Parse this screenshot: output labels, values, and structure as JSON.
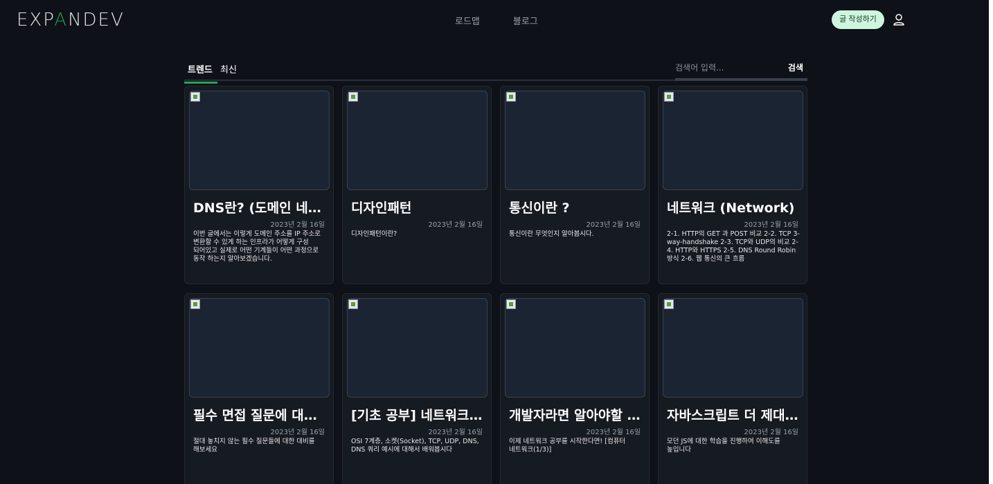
{
  "header": {
    "logo_prefix": "EXP",
    "logo_accent": "A",
    "logo_suffix": "NDEV",
    "nav": [
      {
        "label": "로드맵"
      },
      {
        "label": "블로그"
      }
    ],
    "write_button": "글 작성하기",
    "user_icon": "user-icon"
  },
  "tabs": [
    {
      "label": "트렌드",
      "active": true
    },
    {
      "label": "최신",
      "active": false
    }
  ],
  "search": {
    "placeholder": "검색어 입력...",
    "value": "",
    "button": "검색"
  },
  "colors": {
    "background": "#0e1117",
    "accent": "#22a55a",
    "write_button_bg": "#cff5de"
  },
  "posts": [
    {
      "title": "DNS란? (도메인 네임 시스템 개념부터 작동 방식까지)",
      "date": "2023년 2월 16일",
      "desc": "이번 글에서는 이렇게 도메인 주소를 IP 주소로 변환할 수 있게 하는 인프라가 어떻게 구성 되어있고 실제로 어떤 기계들이 어떤 과정으로 동작 하는지 알아보겠습니다."
    },
    {
      "title": "디자인패턴",
      "date": "2023년 2월 16일",
      "desc": "디자인패턴이란?"
    },
    {
      "title": "통신이란 ?",
      "date": "2023년 2월 16일",
      "desc": "통신이란 무엇인지 알아봅시다."
    },
    {
      "title": "네트워크 (Network)",
      "date": "2023년 2월 16일",
      "desc": "2-1. HTTP의 GET 과 POST 비교 2-2. TCP 3-way-handshake 2-3. TCP와 UDP의 비교 2-4. HTTP와 HTTPS 2-5. DNS Round Robin 방식 2-6. 웹 통신의 큰 흐름"
    },
    {
      "title": "필수 면접 질문에 대한 답변",
      "date": "2023년 2월 16일",
      "desc": "절대 놓치지 않는 필수 질문들에 대한 대비를 해보세요"
    },
    {
      "title": "[기초 공부] 네트워크 기초",
      "date": "2023년 2월 16일",
      "desc": "OSI 7계층, 소켓(Socket), TCP, UDP, DNS, DNS 쿼리 예시에 대해서 배워봅시다"
    },
    {
      "title": "개발자라면 알아야할 네트워크",
      "date": "2023년 2월 16일",
      "desc": "이제 네트워크 공부를 시작한다면! [컴퓨터 네트워크(1/3)]"
    },
    {
      "title": "자바스크립트 더 제대로!",
      "date": "2023년 2월 16일",
      "desc": "모던 JS에 대한 학습을 진행하여 이해도를 높입니다"
    }
  ]
}
